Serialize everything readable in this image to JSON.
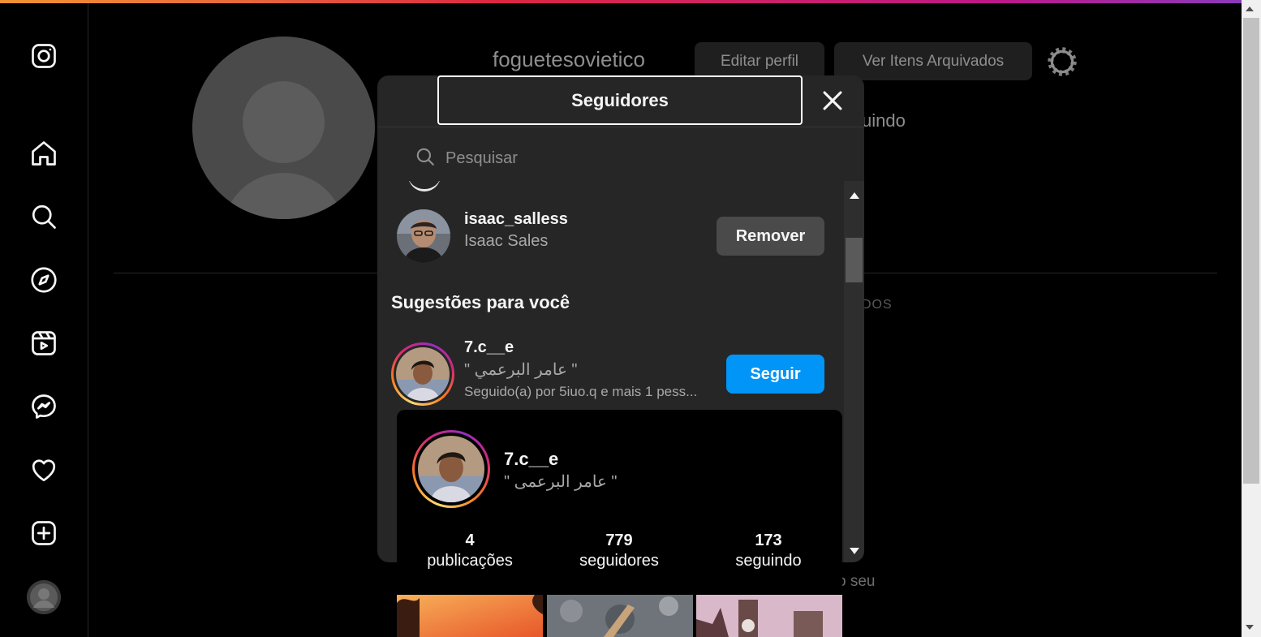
{
  "profile": {
    "username": "foguetesovietico",
    "edit_label": "Editar perfil",
    "archive_label": "Ver Itens Arquivados",
    "seguindo_fragment": "uindo",
    "tab_fragment": "DOS",
    "bottom_fragment": "o seu"
  },
  "modal": {
    "title": "Seguidores",
    "search_placeholder": "Pesquisar",
    "followers": [
      {
        "username": "isaac_salless",
        "full_name": "Isaac Sales",
        "action": "Remover"
      }
    ],
    "suggestions_title": "Sugestões para você",
    "suggestions": [
      {
        "username": "7.c__e",
        "full_name": "\" عامر البرعمي \"",
        "meta": "Seguido(a) por 5iuo.q e mais 1 pess...",
        "action": "Seguir"
      }
    ]
  },
  "hovercard": {
    "username": "7.c__e",
    "full_name": "\" عامر البرعمى \"",
    "stats": [
      {
        "value": "4",
        "label": "publicações"
      },
      {
        "value": "779",
        "label": "seguidores"
      },
      {
        "value": "173",
        "label": "seguindo"
      }
    ]
  },
  "colors": {
    "accent": "#0095f6",
    "background": "#000000",
    "modal": "#262626"
  },
  "icons": [
    "instagram-icon",
    "home-icon",
    "search-icon",
    "explore-icon",
    "reels-icon",
    "messenger-icon",
    "heart-icon",
    "create-icon",
    "avatar",
    "gear-icon",
    "close-icon"
  ]
}
